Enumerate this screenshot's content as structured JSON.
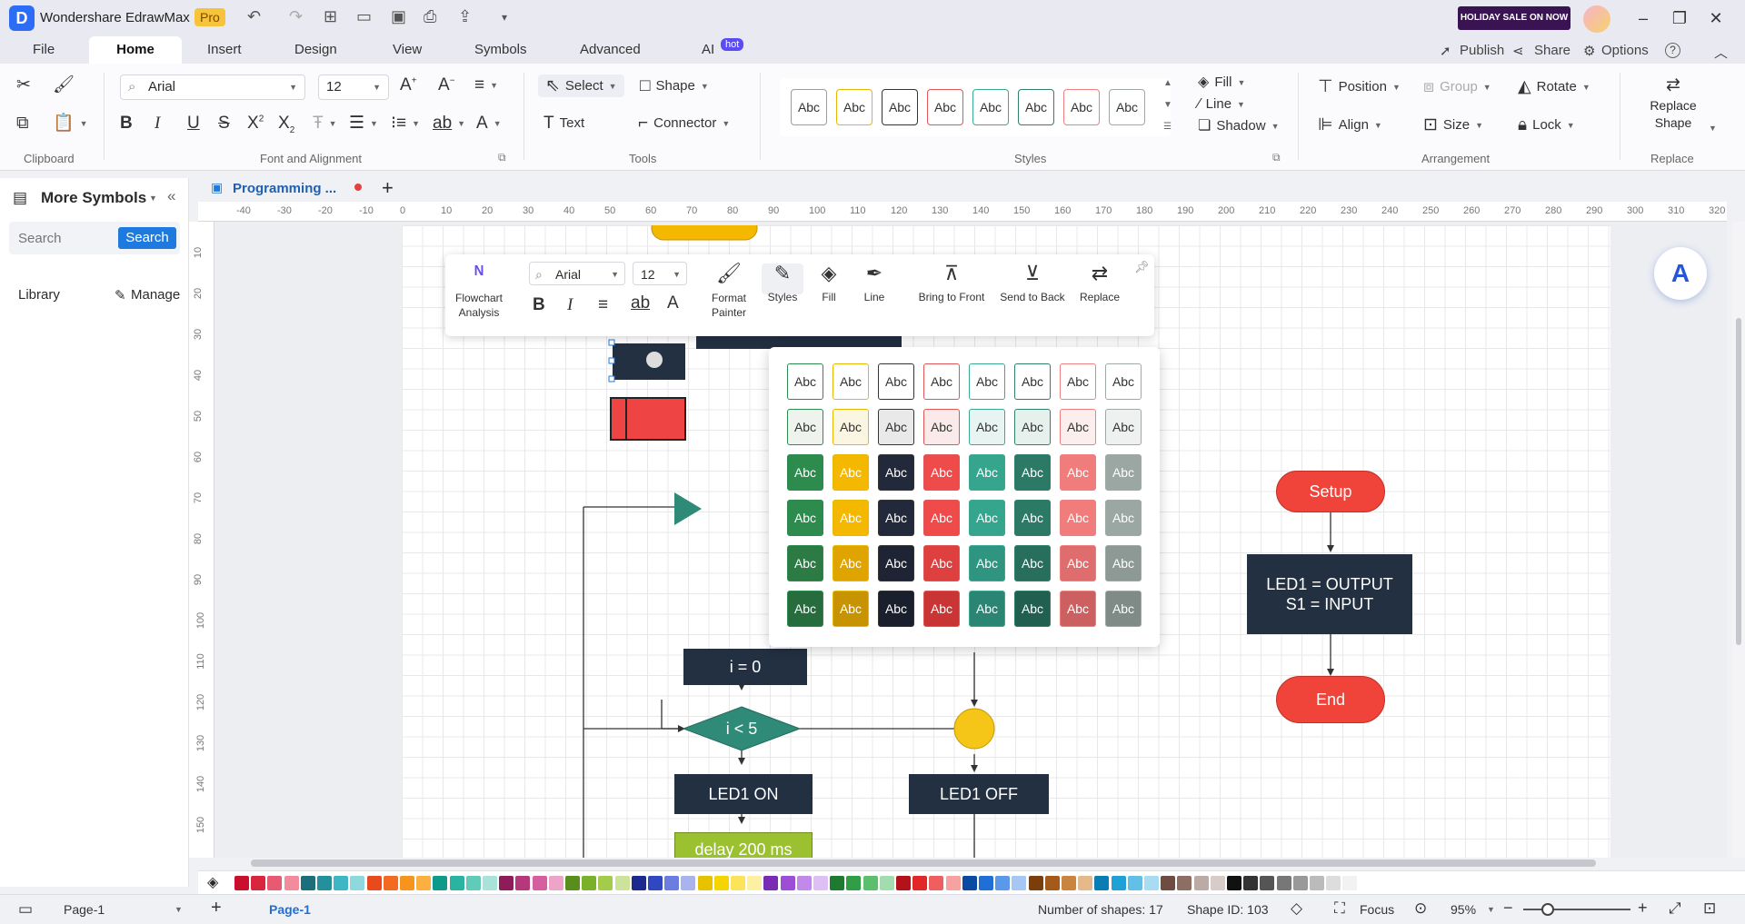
{
  "app": {
    "title": "Wondershare EdrawMax",
    "badge": "Pro",
    "sale": "HOLIDAY SALE ON NOW"
  },
  "menu": {
    "tabs": [
      "File",
      "Home",
      "Insert",
      "Design",
      "View",
      "Symbols",
      "Advanced",
      "AI"
    ],
    "ai_badge": "hot",
    "publish": "Publish",
    "share": "Share",
    "options": "Options",
    "help": "?"
  },
  "ribbon": {
    "clipboard_label": "Clipboard",
    "font_label": "Font and Alignment",
    "font_family": "Arial",
    "font_size": "12",
    "tools_label": "Tools",
    "select": "Select",
    "shape": "Shape",
    "text": "Text",
    "connector": "Connector",
    "styles_label": "Styles",
    "style_sample": "Abc",
    "fill": "Fill",
    "line": "Line",
    "shadow": "Shadow",
    "arrangement_label": "Arrangement",
    "position": "Position",
    "group": "Group",
    "rotate": "Rotate",
    "align": "Align",
    "size": "Size",
    "lock": "Lock",
    "replace_label": "Replace",
    "replace_shape": "Replace Shape",
    "style_borders": [
      "#9c9c9c",
      "#e6b800",
      "#333333",
      "#e05555",
      "#3aaa94",
      "#2f7f6a",
      "#f08080",
      "#a0a8a4"
    ]
  },
  "left_panel": {
    "title": "More Symbols",
    "search_placeholder": "Search",
    "search_button": "Search",
    "library": "Library",
    "manage": "Manage"
  },
  "doc": {
    "tab_title": "Programming ...",
    "add": "+"
  },
  "ruler": {
    "h": [
      "-40",
      "-30",
      "-20",
      "-10",
      "0",
      "10",
      "20",
      "30",
      "40",
      "50",
      "60",
      "70",
      "80",
      "90",
      "100",
      "110",
      "120",
      "130",
      "140",
      "150",
      "160",
      "170",
      "180",
      "190",
      "200",
      "210",
      "220",
      "230",
      "240",
      "250",
      "260",
      "270",
      "280",
      "290",
      "300",
      "310",
      "320"
    ],
    "v": [
      "10",
      "20",
      "30",
      "40",
      "50",
      "60",
      "70",
      "80",
      "90",
      "100",
      "110",
      "120",
      "130",
      "140",
      "150"
    ]
  },
  "floatbar": {
    "flowchart": "Flowchart Analysis",
    "font": "Arial",
    "size": "12",
    "format_painter": "Format Painter",
    "styles": "Styles",
    "fill": "Fill",
    "line": "Line",
    "bring_front": "Bring to Front",
    "send_back": "Send to Back",
    "replace": "Replace"
  },
  "style_popup": {
    "sample": "Abc",
    "rows": [
      [
        "#ffffff",
        "#ffffff",
        "#ffffff",
        "#ffffff",
        "#ffffff",
        "#ffffff",
        "#ffffff",
        "#ffffff"
      ],
      [
        "#eef3ee",
        "#fbf6e2",
        "#e9e9e9",
        "#fbeaea",
        "#e8f4f1",
        "#e6f1ed",
        "#fdeeee",
        "#eef1f0"
      ],
      [
        "#2e8b4e",
        "#f5b800",
        "#22293a",
        "#ef4b4b",
        "#35a58e",
        "#2c7a66",
        "#f07c7c",
        "#9aa7a2"
      ],
      [
        "#2e8b4e",
        "#f5b800",
        "#22293a",
        "#ef4b4b",
        "#35a58e",
        "#2c7a66",
        "#f07c7c",
        "#9aa7a2"
      ],
      [
        "#2c7b45",
        "#e0a400",
        "#1e2433",
        "#de3f3f",
        "#2f9580",
        "#276e5c",
        "#e06d6d",
        "#8c9994"
      ],
      [
        "#266c3c",
        "#c89300",
        "#191f2c",
        "#c93535",
        "#2a8574",
        "#215f50",
        "#cc5f5f",
        "#7e8b86"
      ]
    ],
    "borders": [
      "#2e8b4e",
      "#e6b800",
      "#333333",
      "#e05555",
      "#3aaa94",
      "#2f7f6a",
      "#f08080",
      "#a0a8a4"
    ]
  },
  "diagram": {
    "i0": "i = 0",
    "cond": "i < 5",
    "led_on": "LED1 ON",
    "led_off": "LED1 OFF",
    "delay": "delay 200 ms",
    "setup": "Setup",
    "setup_body": "LED1 = OUTPUT\nS1 = INPUT",
    "end": "End",
    "partial_text": "delay 200 ms"
  },
  "palette": [
    "#c8102e",
    "#d7263d",
    "#e85a71",
    "#f28b9b",
    "#1b6f7a",
    "#23909c",
    "#3cb7c3",
    "#8fd8de",
    "#e84a1c",
    "#f36b21",
    "#f7941d",
    "#fbb040",
    "#0d9a8a",
    "#2ab3a0",
    "#5fcbb8",
    "#a8e2d8",
    "#8e1c5a",
    "#b7377d",
    "#d6609f",
    "#eea3c9",
    "#5a8e1c",
    "#7bb02a",
    "#a2cc4a",
    "#cde39a",
    "#1c2a8e",
    "#3047c2",
    "#6b7de0",
    "#a9b4ef",
    "#e6c200",
    "#f5d400",
    "#fbe35a",
    "#fdf0a3",
    "#7a2bb3",
    "#9d4ed6",
    "#c089ea",
    "#dfc0f5",
    "#1e7a2e",
    "#2f9e44",
    "#5cbf6e",
    "#a3dcae",
    "#b3121b",
    "#e02828",
    "#ef5f5f",
    "#f7a1a1",
    "#0b4aa2",
    "#1f6fd6",
    "#5b98ea",
    "#a6c6f4",
    "#7a3e0c",
    "#a65a1a",
    "#c9853f",
    "#e6b98a",
    "#0a7db3",
    "#1fa0d6",
    "#62bfe6",
    "#a8dcf2",
    "#6d4c41",
    "#8d6e63",
    "#bcaaa4",
    "#d7ccc8",
    "#111111",
    "#333333",
    "#555555",
    "#777777",
    "#999999",
    "#bbbbbb",
    "#dddddd",
    "#f2f2f2"
  ],
  "status": {
    "page_select": "Page-1",
    "page_tab": "Page-1",
    "shapes": "Number of shapes: 17",
    "shape_id": "Shape ID: 103",
    "focus": "Focus",
    "zoom": "95%"
  }
}
